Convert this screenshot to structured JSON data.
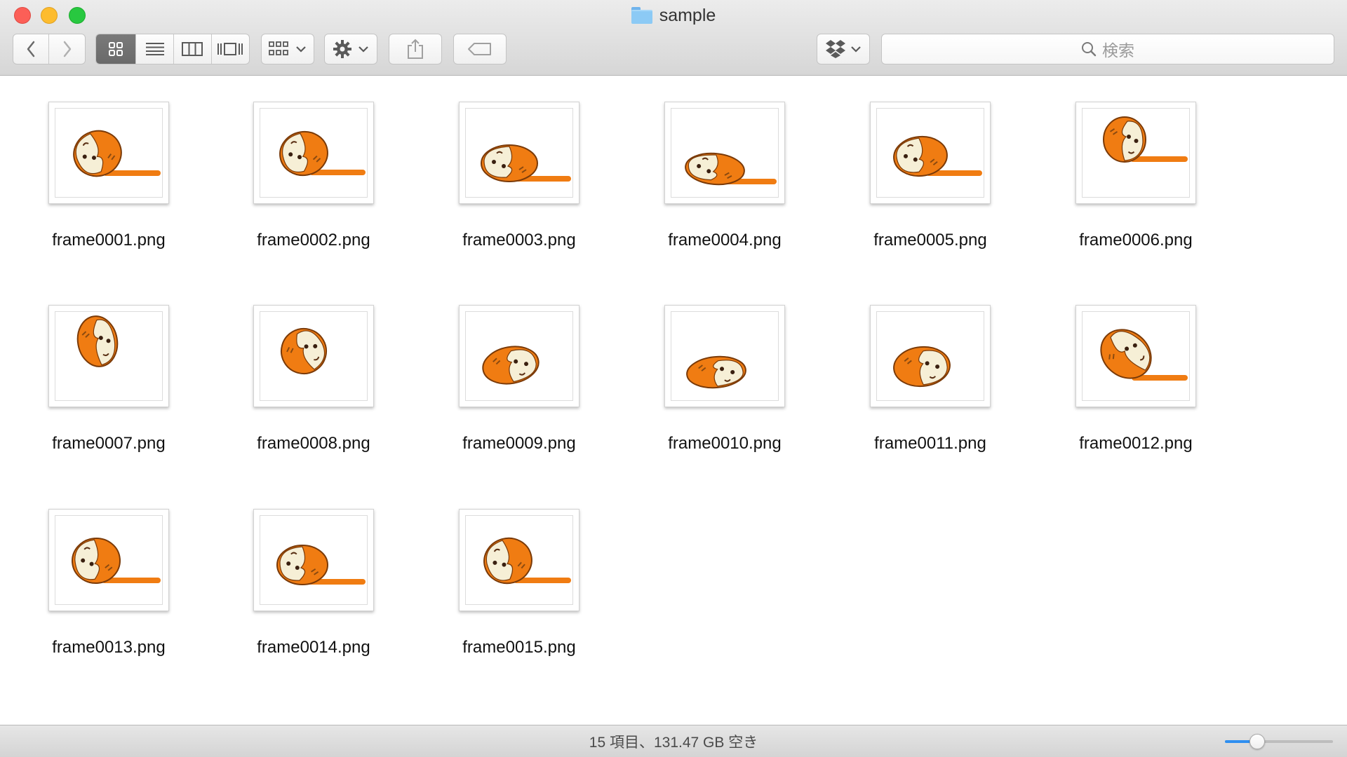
{
  "window": {
    "title": "sample",
    "title_icon": "folder-icon"
  },
  "toolbar": {
    "back_icon": "chevron-left-icon",
    "forward_icon": "chevron-right-icon",
    "view_modes": [
      {
        "icon": "icon-view-icon",
        "active": true
      },
      {
        "icon": "list-view-icon",
        "active": false
      },
      {
        "icon": "column-view-icon",
        "active": false
      },
      {
        "icon": "coverflow-view-icon",
        "active": false
      }
    ],
    "arrange_icon": "arrange-icon",
    "action_icon": "gear-icon",
    "share_icon": "share-icon",
    "tag_icon": "tag-icon",
    "dropbox_icon": "dropbox-icon",
    "search": {
      "placeholder": "検索"
    }
  },
  "files": [
    {
      "name": "frame0001.png"
    },
    {
      "name": "frame0002.png"
    },
    {
      "name": "frame0003.png"
    },
    {
      "name": "frame0004.png"
    },
    {
      "name": "frame0005.png"
    },
    {
      "name": "frame0006.png"
    },
    {
      "name": "frame0007.png"
    },
    {
      "name": "frame0008.png"
    },
    {
      "name": "frame0009.png"
    },
    {
      "name": "frame0010.png"
    },
    {
      "name": "frame0011.png"
    },
    {
      "name": "frame0012.png"
    },
    {
      "name": "frame0013.png"
    },
    {
      "name": "frame0014.png"
    },
    {
      "name": "frame0015.png"
    }
  ],
  "statusbar": {
    "text": "15 項目、131.47 GB 空き",
    "zoom_level": 0.3
  },
  "colors": {
    "accent": "#2f8ff0",
    "thumbnail_orange": "#f07c12",
    "thumbnail_cream": "#f6efd6"
  }
}
